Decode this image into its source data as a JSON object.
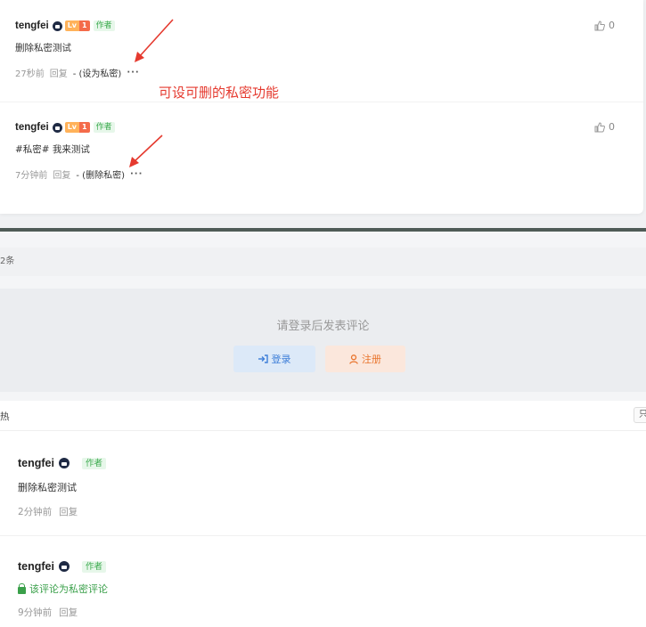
{
  "top": {
    "comments": [
      {
        "username": "tengfei",
        "level_badge_a": "Lv",
        "level_badge_b": "1",
        "author_tag": "作者",
        "text": "删除私密测试",
        "time": "27秒前",
        "reply": "回复",
        "action": "- (设为私密)",
        "more": "···",
        "likes": "0"
      },
      {
        "username": "tengfei",
        "level_badge_a": "Lv",
        "level_badge_b": "1",
        "author_tag": "作者",
        "text": "#私密# 我来测试",
        "time": "7分钟前",
        "reply": "回复",
        "action": "- (删除私密)",
        "more": "···",
        "likes": "0"
      }
    ],
    "annotation": "可设可删的私密功能",
    "annotation_color": "#e53a2f"
  },
  "bottom": {
    "count_text": "2条",
    "login_hint": "请登录后发表评论",
    "login_button": "登录",
    "register_button": "注册",
    "sort_left": "热",
    "sort_right": "只",
    "comments": [
      {
        "username": "tengfei",
        "author_tag": "作者",
        "text": "删除私密测试",
        "time": "2分钟前",
        "reply": "回复"
      },
      {
        "username": "tengfei",
        "author_tag": "作者",
        "text": "该评论为私密评论",
        "time": "9分钟前",
        "reply": "回复"
      }
    ]
  },
  "colors": {
    "author_green": "#3aaa4c",
    "login_blue": "#3d7ed8",
    "register_orange": "#e9742c",
    "private_green": "#3aa04a"
  },
  "icons": [
    "lock-icon",
    "thumb-up-icon",
    "login-icon",
    "user-icon",
    "padlock-icon",
    "arrow-annotation-icon"
  ]
}
